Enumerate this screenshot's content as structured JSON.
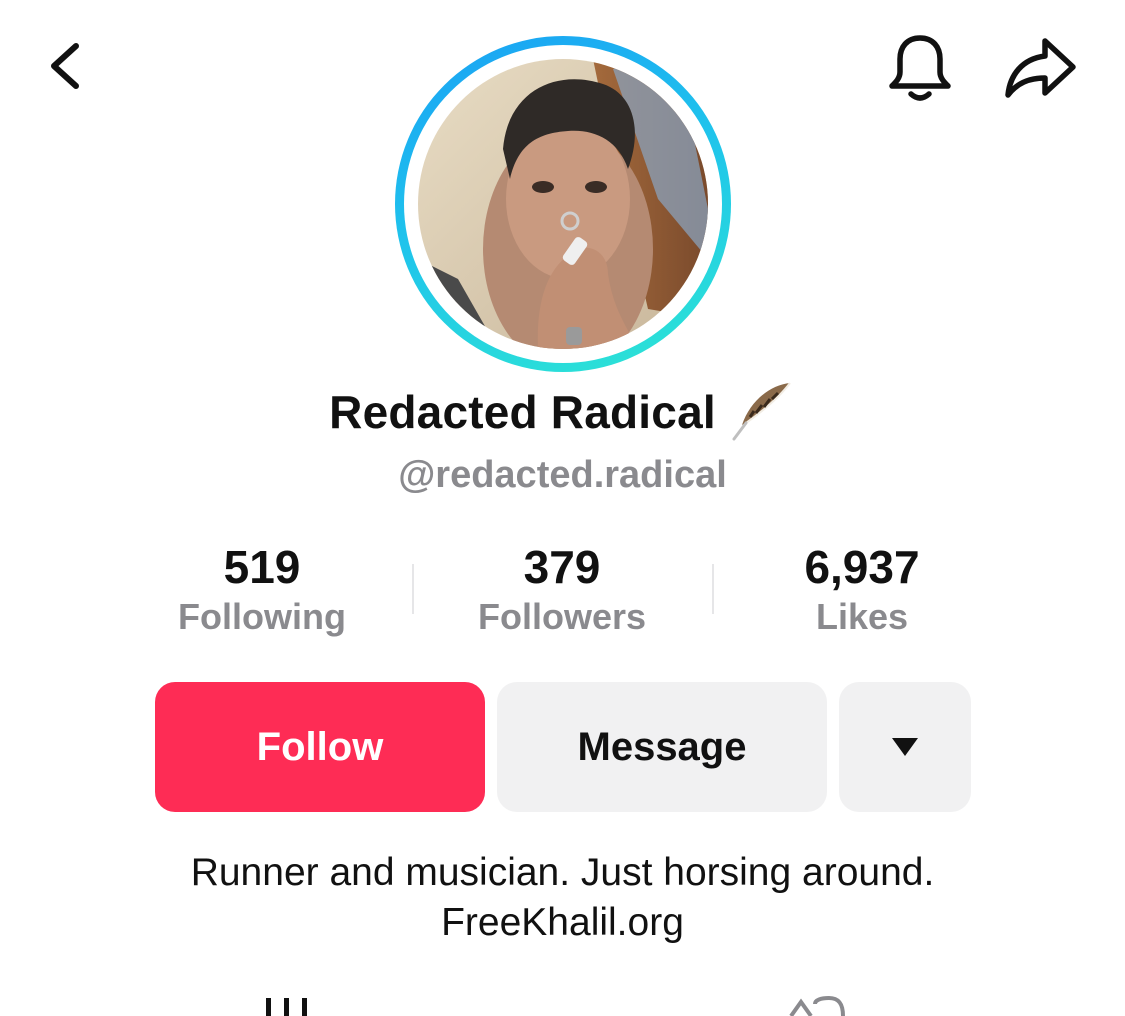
{
  "header": {
    "back_icon": "chevron-left-icon",
    "notifications_icon": "bell-icon",
    "share_icon": "share-arrow-icon"
  },
  "profile": {
    "avatar_ring_colors": [
      "#1aa0f5",
      "#2ee6d3"
    ],
    "display_name": "Redacted Radical",
    "name_emoji": "feather-icon",
    "username": "@redacted.radical"
  },
  "stats": [
    {
      "value": "519",
      "label": "Following"
    },
    {
      "value": "379",
      "label": "Followers"
    },
    {
      "value": "6,937",
      "label": "Likes"
    }
  ],
  "actions": {
    "follow_label": "Follow",
    "message_label": "Message",
    "more_icon": "caret-down-icon",
    "follow_color": "#fe2c55"
  },
  "bio": {
    "line1": "Runner and musician. Just horsing around.",
    "link": "FreeKhalil.org"
  },
  "tabs": {
    "videos_icon": "grid-icon",
    "reposts_icon": "repost-icon"
  }
}
